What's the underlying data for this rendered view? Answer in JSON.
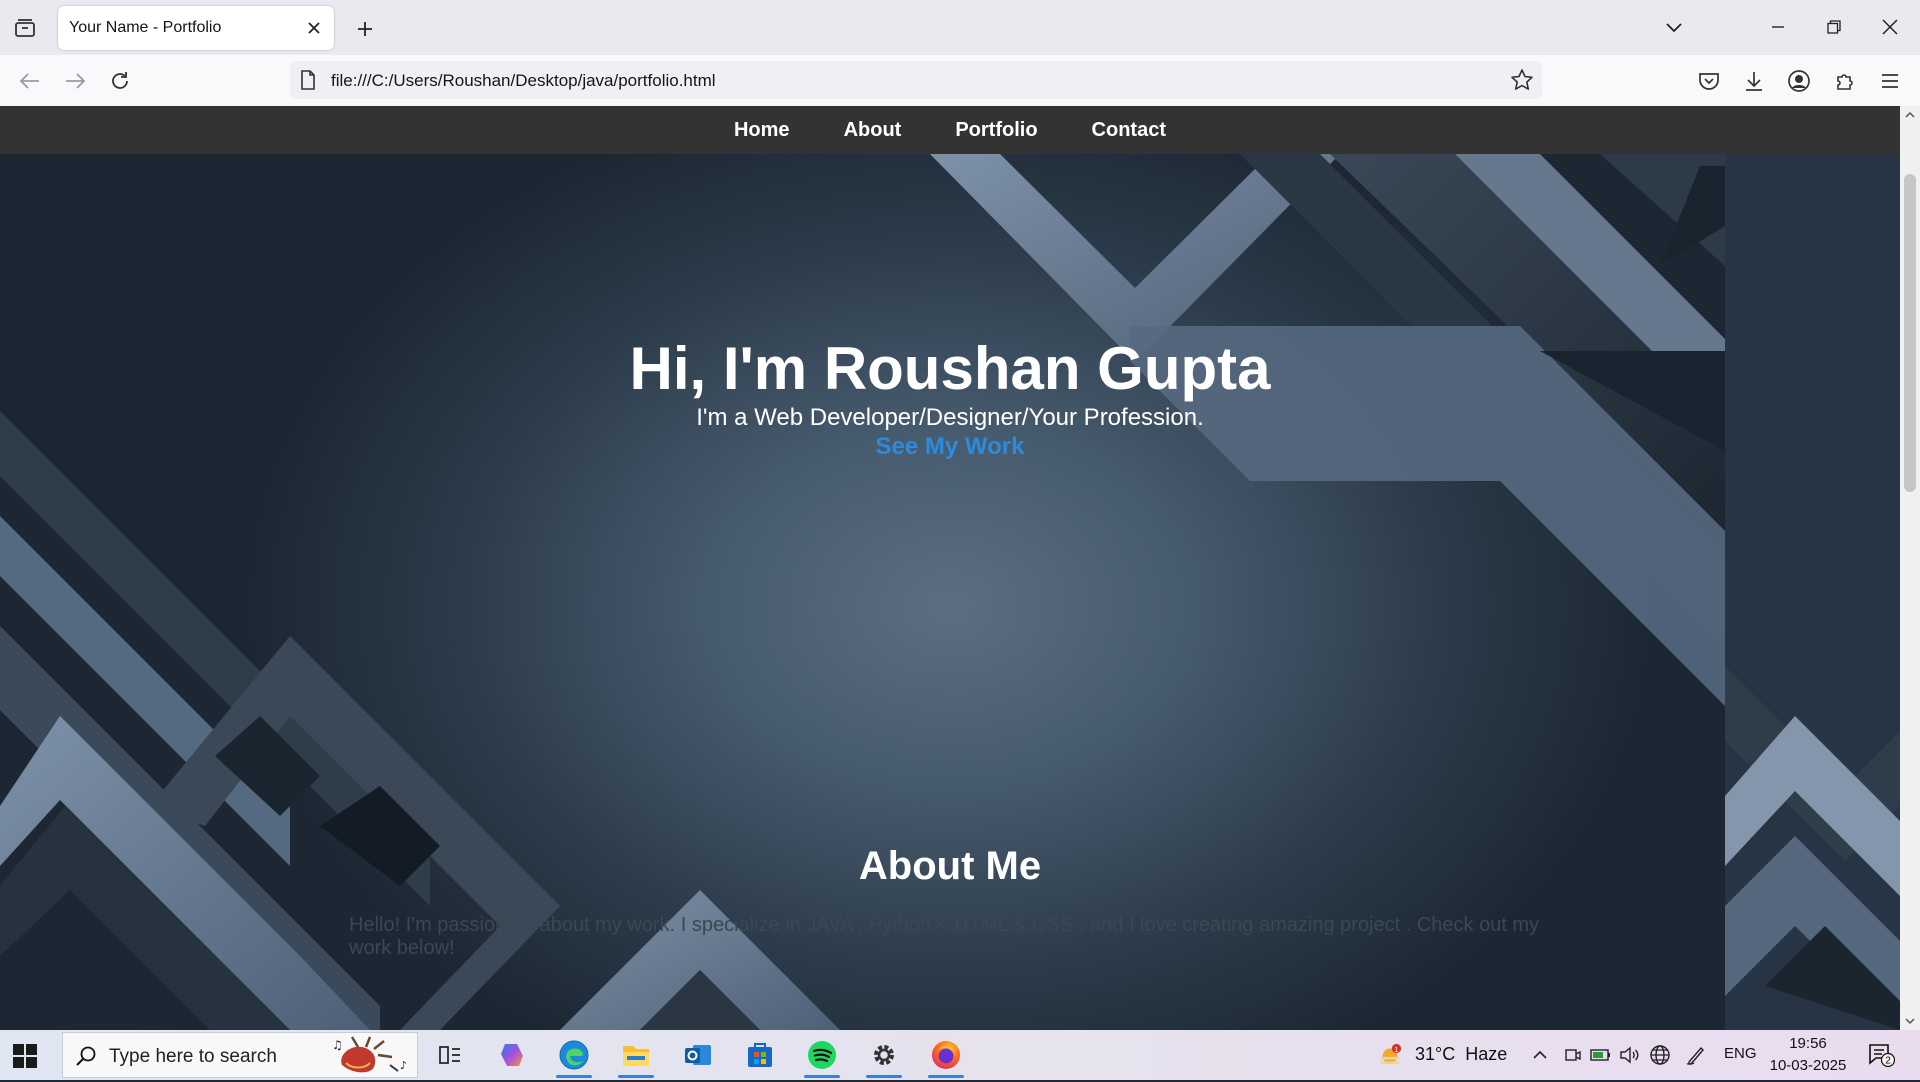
{
  "browser": {
    "tab_title": "Your Name - Portfolio",
    "url": "file:///C:/Users/Roushan/Desktop/java/portfolio.html"
  },
  "site": {
    "nav": [
      "Home",
      "About",
      "Portfolio",
      "Contact"
    ],
    "hero": {
      "title": "Hi, I'm Roushan Gupta",
      "subtitle": "I'm a Web Developer/Designer/Your Profession.",
      "cta": "See My Work"
    },
    "about": {
      "title": "About Me",
      "text": "Hello! I'm passionate about my work. I specialize in JAVA , Python < HTML & CSS , and I love creating amazing project . Check out my work below!"
    },
    "colors": {
      "nav_bg": "#333333",
      "link": "#2e8bdc"
    }
  },
  "taskbar": {
    "search_placeholder": "Type here to search",
    "weather": "31°C  Haze",
    "weather_badge": "1",
    "language": "ENG",
    "time": "19:56",
    "date": "10-03-2025",
    "notifications": "2",
    "apps": [
      "task-view",
      "copilot",
      "edge",
      "file-explorer",
      "outlook",
      "microsoft-store",
      "spotify",
      "settings",
      "firefox"
    ]
  }
}
